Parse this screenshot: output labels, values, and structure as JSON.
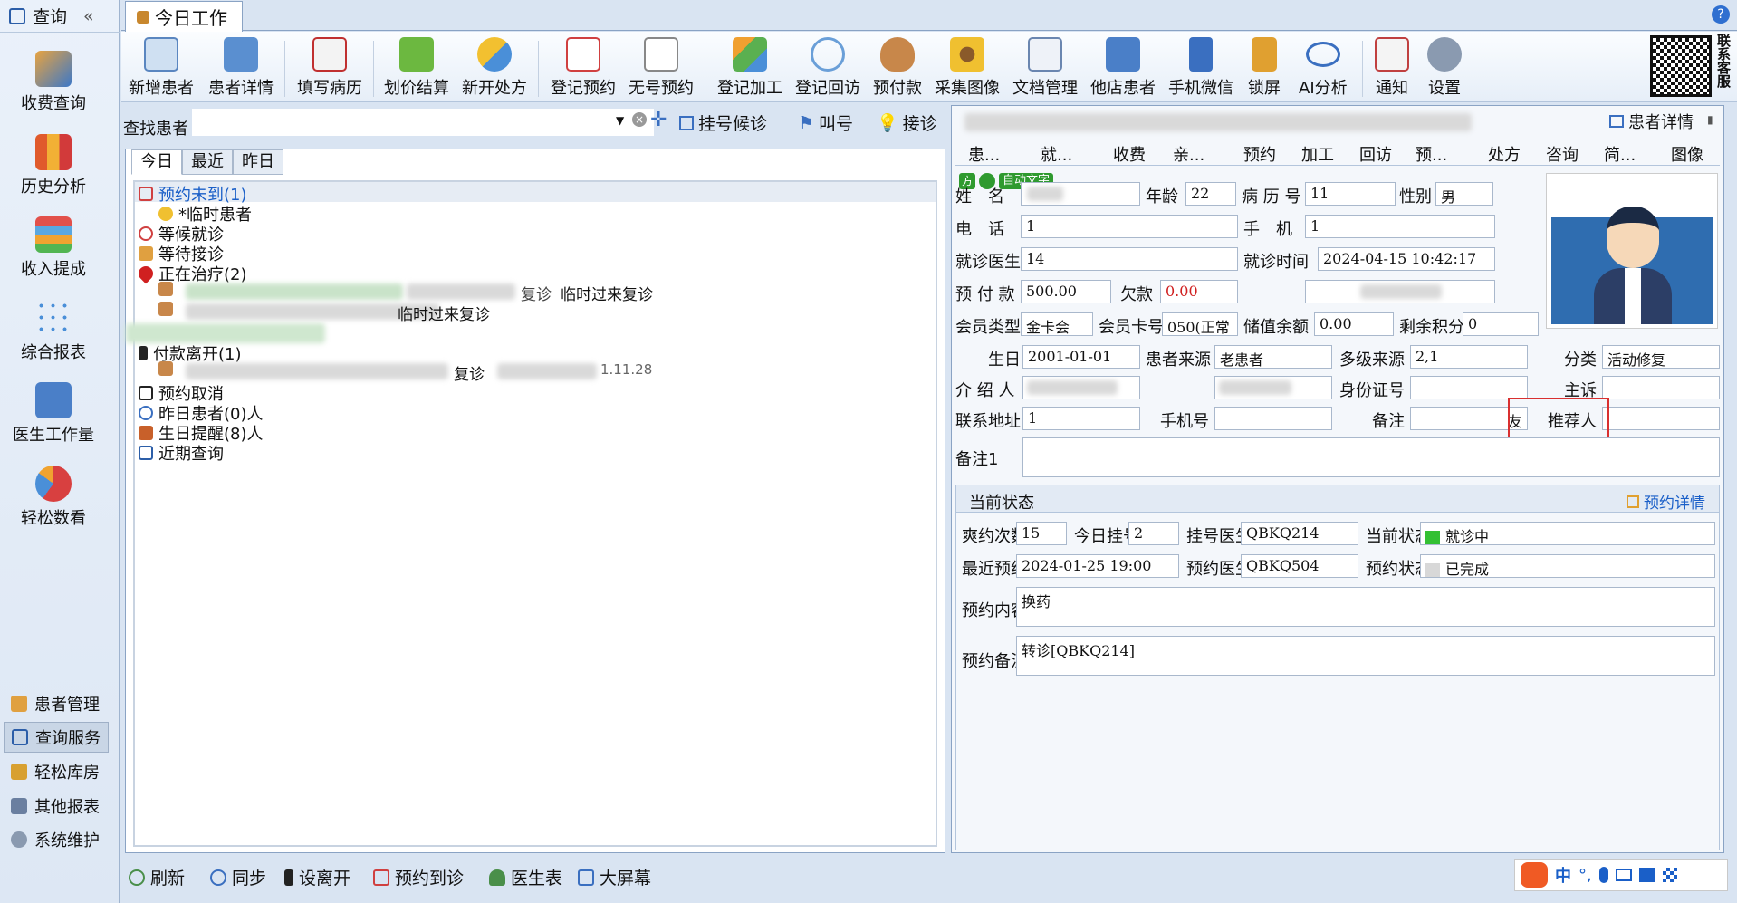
{
  "nav": {
    "header": "查询",
    "collapse": "«",
    "big_items": [
      {
        "label": "收费查询"
      },
      {
        "label": "历史分析"
      },
      {
        "label": "收入提成"
      },
      {
        "label": "综合报表"
      },
      {
        "label": "医生工作量"
      },
      {
        "label": "轻松数看"
      }
    ],
    "small_items": [
      {
        "label": "患者管理"
      },
      {
        "label": "查询服务"
      },
      {
        "label": "轻松库房"
      },
      {
        "label": "其他报表"
      },
      {
        "label": "系统维护"
      }
    ]
  },
  "tab": {
    "label": "今日工作",
    "help": "?"
  },
  "toolbar": [
    {
      "label": "新增患者"
    },
    {
      "label": "患者详情"
    },
    {
      "label": "填写病历"
    },
    {
      "label": "划价结算"
    },
    {
      "label": "新开处方"
    },
    {
      "label": "登记预约"
    },
    {
      "label": "无号预约"
    },
    {
      "label": "登记加工"
    },
    {
      "label": "登记回访"
    },
    {
      "label": "预付款"
    },
    {
      "label": "采集图像"
    },
    {
      "label": "文档管理"
    },
    {
      "label": "他店患者"
    },
    {
      "label": "手机微信"
    },
    {
      "label": "锁屏"
    },
    {
      "label": "AI分析"
    },
    {
      "label": "通知"
    },
    {
      "label": "设置"
    }
  ],
  "contact_vertical": "联系客服",
  "search": {
    "label": "查找患者",
    "value": "",
    "register": "挂号候诊",
    "call": "叫号",
    "receive": "接诊"
  },
  "subtabs": [
    "今日",
    "最近",
    "昨日"
  ],
  "tree": [
    {
      "label": "预约未到(1)",
      "color": "#1a5fc8"
    },
    {
      "label": "*临时患者",
      "color": "#111"
    },
    {
      "label": "等候就诊",
      "color": "#111"
    },
    {
      "label": "等待接诊",
      "color": "#111"
    },
    {
      "label": "正在治疗(2)",
      "color": "#111"
    },
    {
      "label": "付款离开(1)",
      "color": "#111"
    },
    {
      "label": "预约取消",
      "color": "#111"
    },
    {
      "label": "昨日患者(0)人",
      "color": "#111"
    },
    {
      "label": "生日提醒(8)人",
      "color": "#111"
    },
    {
      "label": "近期查询",
      "color": "#111"
    }
  ],
  "tree_frags": [
    "复诊",
    "临时过来复诊",
    "复诊",
    "1.11.28"
  ],
  "right": {
    "title_btn": "患者详情",
    "tabs": [
      "患...",
      "就...",
      "收费",
      "亲...",
      "预约",
      "加工",
      "回访",
      "预...",
      "处方",
      "咨询",
      "简...",
      "图像"
    ],
    "badges": {
      "b1": "方",
      "b2": "自动文字"
    },
    "labels": {
      "name": "姓　名",
      "age": "年龄",
      "record": "病 历 号",
      "sex": "性别",
      "phone": "电　话",
      "mobile": "手　机",
      "doctor": "就诊医生",
      "visit_time": "就诊时间",
      "prepay": "预 付 款",
      "debt": "欠款",
      "member": "会员类型",
      "card": "会员卡号",
      "balance": "储值余额",
      "points": "剩余积分",
      "birth": "生日",
      "source": "患者来源",
      "multi_source": "多级来源",
      "category": "分类",
      "intro": "介 绍 人",
      "idcard": "身份证号",
      "complaint": "主诉",
      "address": "联系地址",
      "mobile2": "手机号",
      "note": "备注",
      "referrer": "推荐人",
      "note1": "备注1"
    },
    "values": {
      "age": "22",
      "record": "11",
      "sex": "男",
      "phone": "1",
      "mobile": "1",
      "doctor": "14",
      "visit_time": "2024-04-15 10:42:17",
      "prepay": "500.00",
      "debt": "0.00",
      "member": "金卡会",
      "card": "050(正常",
      "balance": "0.00",
      "points": "0",
      "birth": "2001-01-01",
      "source": "老患者",
      "multi_source": "2,1",
      "category": "活动修复",
      "address": "1",
      "note": "友"
    },
    "status": {
      "title": "当前状态",
      "detail": "预约详情",
      "labels": {
        "miss": "爽约次数",
        "today": "今日挂号",
        "reg_doc": "挂号医生",
        "cur": "当前状态",
        "last": "最近预约",
        "appt_doc": "预约医生",
        "appt_state": "预约状态",
        "content": "预约内容",
        "remark": "预约备注"
      },
      "values": {
        "miss": "15",
        "today": "2",
        "reg_doc": "QBKQ214",
        "cur": "就诊中",
        "last": "2024-01-25 19:00",
        "appt_doc": "QBKQ504",
        "appt_state": "已完成",
        "content": "换药",
        "remark": "转诊[QBKQ214]"
      },
      "colors": {
        "cur": "#33c033",
        "appt_state": "#d8d8d8"
      }
    }
  },
  "footer": [
    {
      "label": "刷新"
    },
    {
      "label": "同步"
    },
    {
      "label": "设离开"
    },
    {
      "label": "预约到诊"
    },
    {
      "label": "医生表"
    },
    {
      "label": "大屏幕"
    }
  ],
  "ime": {
    "zh": "中",
    "punct": "°,"
  }
}
